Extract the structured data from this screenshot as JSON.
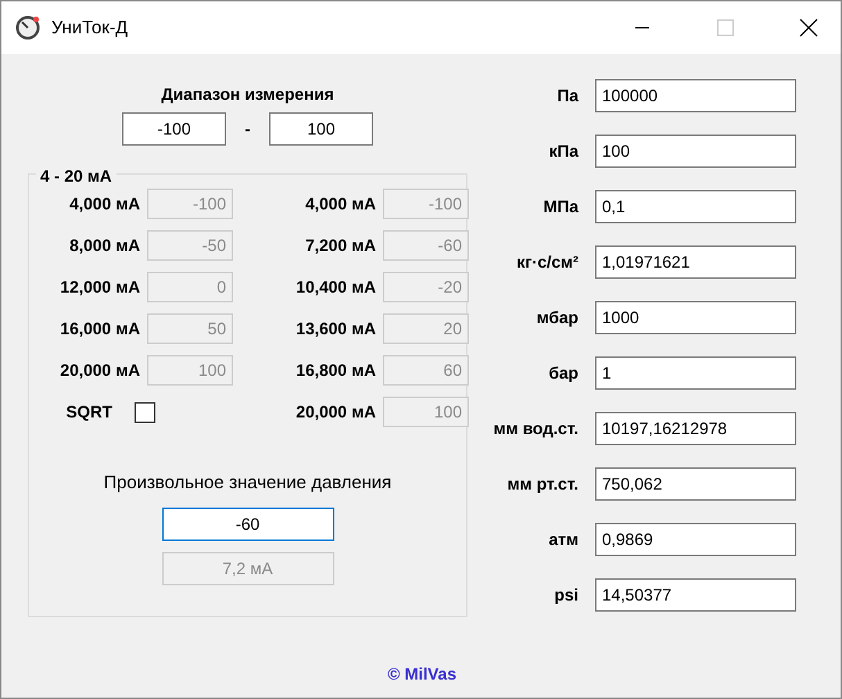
{
  "window": {
    "title": "УниТок-Д"
  },
  "range": {
    "label": "Диапазон измерения",
    "from": "-100",
    "separator": "-",
    "to": "100"
  },
  "group": {
    "title": "4 - 20 мА",
    "left_rows": [
      {
        "label": "4,000 мА",
        "value": "-100",
        "disabled": true
      },
      {
        "label": "8,000 мА",
        "value": "-50",
        "disabled": true
      },
      {
        "label": "12,000 мА",
        "value": "0",
        "disabled": true
      },
      {
        "label": "16,000 мА",
        "value": "50",
        "disabled": true
      },
      {
        "label": "20,000 мА",
        "value": "100",
        "disabled": true
      }
    ],
    "sqrt": {
      "label": "SQRT",
      "checked": false
    },
    "right_rows": [
      {
        "label": "4,000 мА",
        "value": "-100",
        "disabled": true
      },
      {
        "label": "7,200 мА",
        "value": "-60",
        "disabled": true
      },
      {
        "label": "10,400 мА",
        "value": "-20",
        "disabled": true
      },
      {
        "label": "13,600 мА",
        "value": "20",
        "disabled": true
      },
      {
        "label": "16,800 мА",
        "value": "60",
        "disabled": true
      },
      {
        "label": "20,000 мА",
        "value": "100",
        "disabled": true
      }
    ],
    "custom": {
      "label": "Произвольное значение давления",
      "value": "-60",
      "focused": true,
      "result": "7,2 мА",
      "result_disabled": true
    }
  },
  "units": [
    {
      "label": "Па",
      "value": "100000"
    },
    {
      "label": "кПа",
      "value": "100"
    },
    {
      "label": "МПа",
      "value": "0,1"
    },
    {
      "label": "кг·с/см²",
      "value": "1,01971621"
    },
    {
      "label": "мбар",
      "value": "1000"
    },
    {
      "label": "бар",
      "value": "1"
    },
    {
      "label": "мм вод.ст.",
      "value": "10197,16212978"
    },
    {
      "label": "мм рт.ст.",
      "value": "750,062"
    },
    {
      "label": "атм",
      "value": "0,9869"
    },
    {
      "label": "psi",
      "value": "14,50377"
    }
  ],
  "footer": "© MilVas"
}
